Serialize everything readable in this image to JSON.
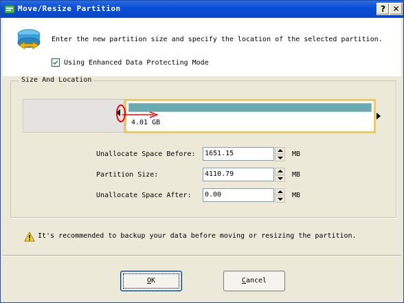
{
  "window": {
    "title": "Move/Resize Partition",
    "help_label": "?",
    "close_label": "✕"
  },
  "header": {
    "instruction": "Enter the new partition size and specify the location of the selected partition.",
    "checkbox_label": "Using Enhanced Data Protecting Mode",
    "checkbox_checked": true
  },
  "size_location": {
    "group_label": "Size And Location",
    "partition_label": "4.01 GB",
    "fields": [
      {
        "label": "Unallocate Space Before:",
        "value": "1651.15",
        "unit": "MB"
      },
      {
        "label": "Partition Size:",
        "value": "4110.79",
        "unit": "MB"
      },
      {
        "label": "Unallocate Space After:",
        "value": "0.00",
        "unit": "MB"
      }
    ]
  },
  "warning": "It's recommended to backup your data before moving or resizing the partition.",
  "buttons": {
    "ok_label": "OK",
    "ok_mnemonic": "O",
    "ok_rest": "K",
    "cancel_label": "Cancel",
    "cancel_mnemonic": "C",
    "cancel_rest": "ancel"
  },
  "colors": {
    "titlebar": "#0a4fd8",
    "partition_bar": "#6aaab3",
    "partition_border": "#e8c96a",
    "annotation": "#ee0000"
  }
}
